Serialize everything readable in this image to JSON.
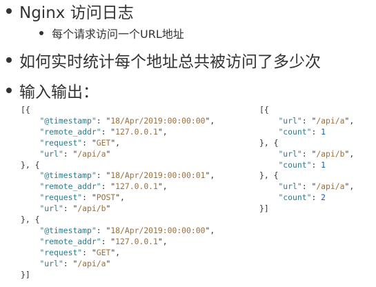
{
  "bullets": [
    {
      "text": "Nginx 访问日志"
    },
    {
      "text": "每个请求访问一个URL地址"
    },
    {
      "text": "如何实时统计每个地址总共被访问了多少次"
    },
    {
      "text": "输入输出："
    }
  ],
  "input_example": [
    {
      "timestamp": "18/Apr/2019:00:00:00",
      "remote_addr": "127.0.0.1",
      "request": "GET",
      "url": "/api/a"
    },
    {
      "timestamp": "18/Apr/2019:00:00:01",
      "remote_addr": "127.0.0.1",
      "request": "POST",
      "url": "/api/b"
    },
    {
      "timestamp": "18/Apr/2019:00:00:00",
      "remote_addr": "127.0.0.1",
      "request": "GET",
      "url": "/api/a"
    }
  ],
  "output_example": [
    {
      "url": "/api/a",
      "count": "1"
    },
    {
      "url": "/api/b",
      "count": "1"
    },
    {
      "url": "/api/a",
      "count": "2"
    }
  ],
  "json_keys": {
    "timestamp": "\"@timestamp\"",
    "remote_addr": "\"remote_addr\"",
    "request": "\"request\"",
    "url": "\"url\"",
    "count": "\"count\""
  },
  "colors": {
    "text": "#333333",
    "json_key": "#2a7a8c",
    "json_string": "#9a6e3a",
    "json_number": "#1a5ca8"
  }
}
